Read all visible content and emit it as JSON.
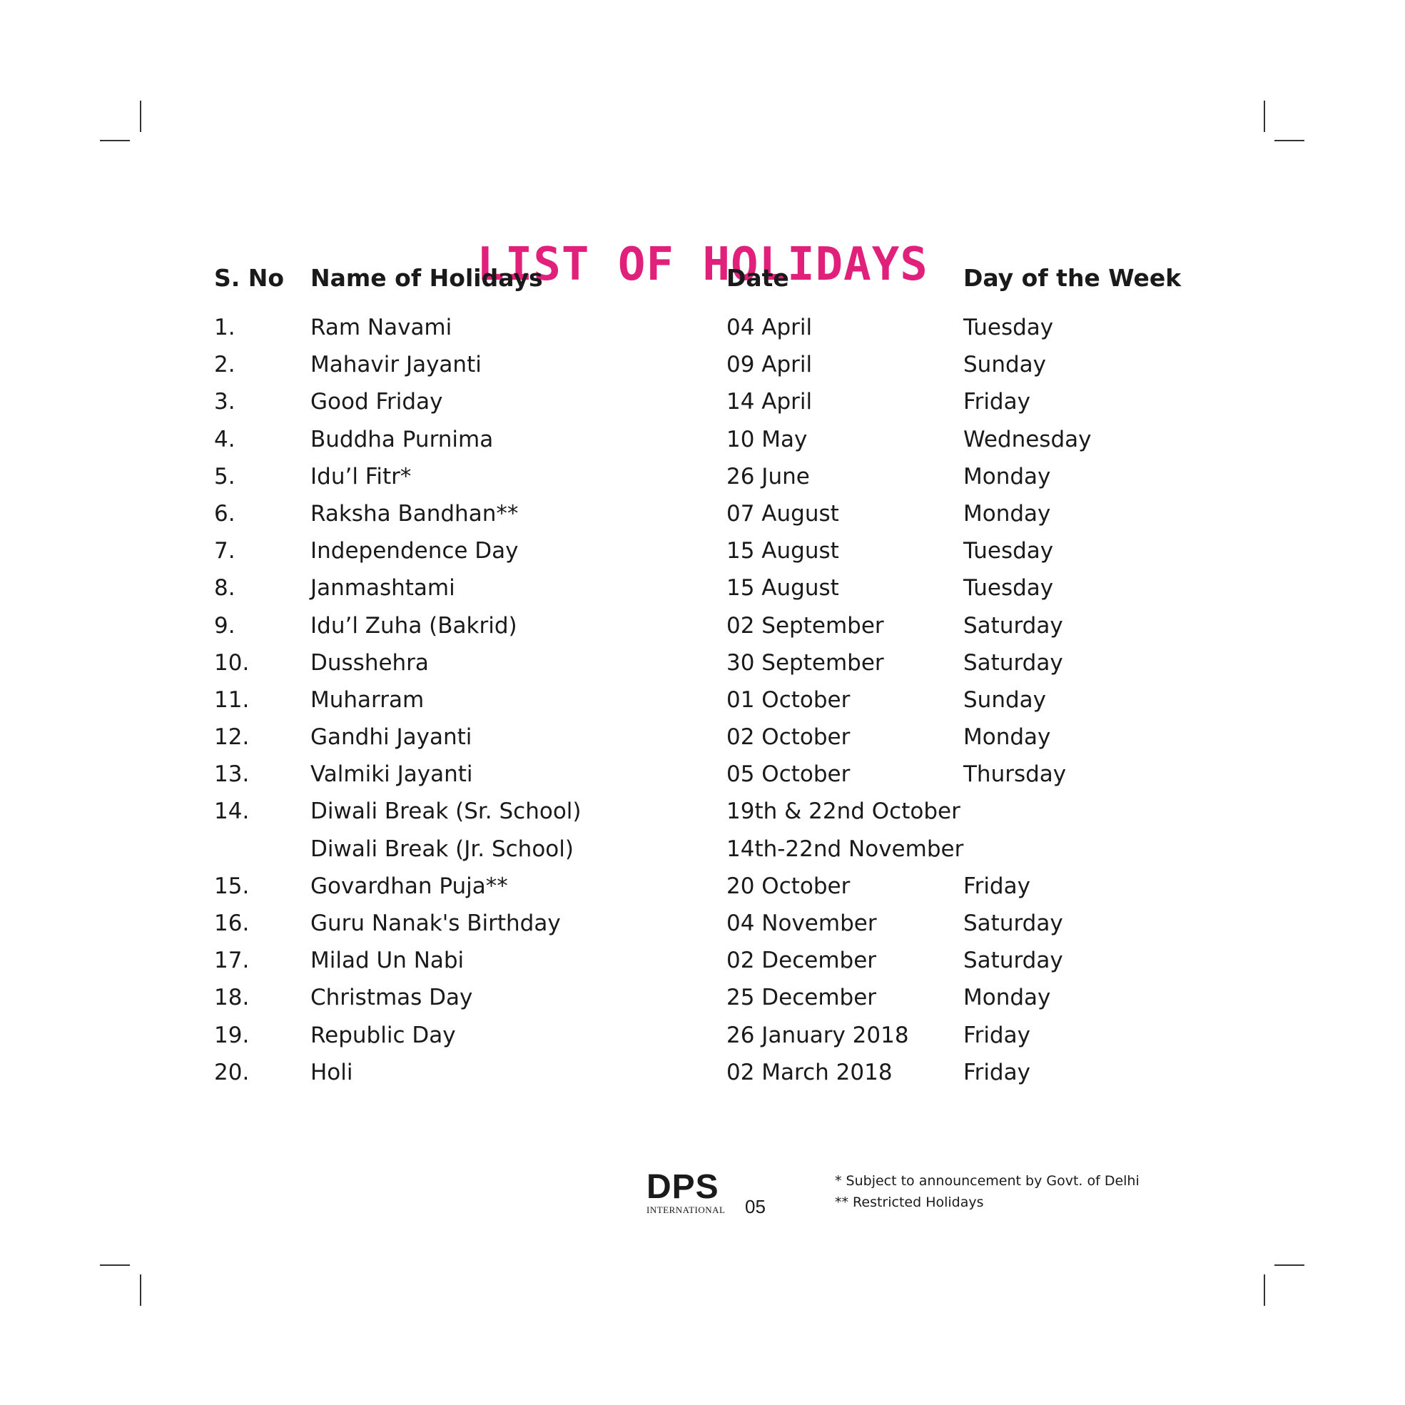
{
  "title": "LIST OF HOLIDAYS",
  "accent_color": "#e0207a",
  "headers": {
    "sno": "S. No",
    "name": "Name of Holidays",
    "date": "Date",
    "day": "Day of the Week"
  },
  "rows": [
    {
      "sno": "1.",
      "name": "Ram Navami",
      "date": "04 April",
      "day": "Tuesday"
    },
    {
      "sno": "2.",
      "name": "Mahavir Jayanti",
      "date": "09 April",
      "day": "Sunday"
    },
    {
      "sno": "3.",
      "name": "Good Friday",
      "date": "14 April",
      "day": "Friday"
    },
    {
      "sno": "4.",
      "name": "Buddha Purnima",
      "date": "10 May",
      "day": "Wednesday"
    },
    {
      "sno": "5.",
      "name": "Idu’l Fitr*",
      "date": "26 June",
      "day": "Monday"
    },
    {
      "sno": "6.",
      "name": "Raksha Bandhan**",
      "date": "07 August",
      "day": "Monday"
    },
    {
      "sno": "7.",
      "name": "Independence Day",
      "date": "15 August",
      "day": "Tuesday"
    },
    {
      "sno": "8.",
      "name": "Janmashtami",
      "date": "15 August",
      "day": "Tuesday"
    },
    {
      "sno": "9.",
      "name": "Idu’l Zuha (Bakrid)",
      "date": "02 September",
      "day": "Saturday"
    },
    {
      "sno": "10.",
      "name": "Dusshehra",
      "date": "30 September",
      "day": "Saturday"
    },
    {
      "sno": "11.",
      "name": "Muharram",
      "date": "01 October",
      "day": "Sunday"
    },
    {
      "sno": "12.",
      "name": "Gandhi Jayanti",
      "date": "02 October",
      "day": "Monday"
    },
    {
      "sno": "13.",
      "name": "Valmiki Jayanti",
      "date": "05 October",
      "day": "Thursday"
    },
    {
      "sno": "14.",
      "name": "Diwali Break (Sr. School)",
      "date": "19th & 22nd October",
      "day": ""
    },
    {
      "sno": "",
      "name": "Diwali Break (Jr. School)",
      "date": "14th-22nd November",
      "day": ""
    },
    {
      "sno": "15.",
      "name": "Govardhan Puja**",
      "date": "20 October",
      "day": "Friday"
    },
    {
      "sno": "16.",
      "name": "Guru Nanak's Birthday",
      "date": "04 November",
      "day": "Saturday"
    },
    {
      "sno": "17.",
      "name": "Milad Un Nabi",
      "date": "02 December",
      "day": "Saturday"
    },
    {
      "sno": "18.",
      "name": "Christmas Day",
      "date": "25 December",
      "day": "Monday"
    },
    {
      "sno": "19.",
      "name": "Republic Day",
      "date": "26 January 2018",
      "day": "Friday"
    },
    {
      "sno": "20.",
      "name": "Holi",
      "date": "02 March 2018",
      "day": "Friday"
    }
  ],
  "footer": {
    "logo_main": "DPS",
    "logo_sub": "INTERNATIONAL",
    "page_number": "05",
    "notes": [
      "* Subject to announcement by Govt. of Delhi",
      "** Restricted Holidays"
    ]
  }
}
